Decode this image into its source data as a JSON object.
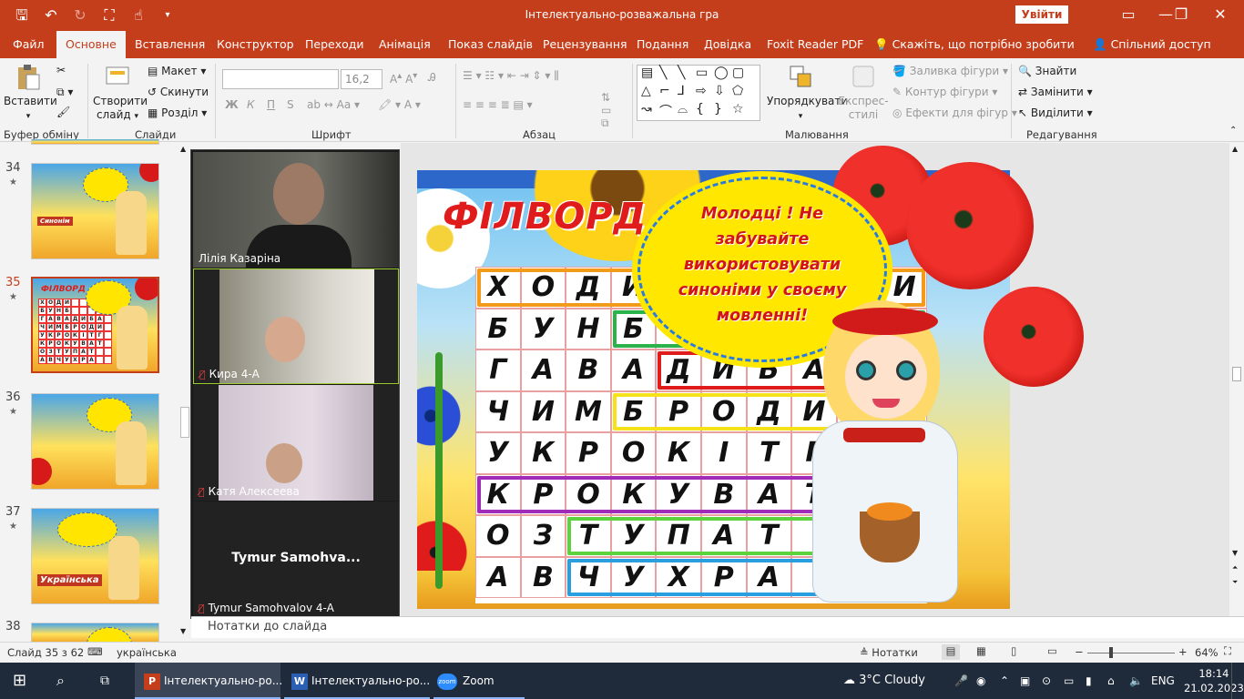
{
  "window": {
    "title": "Інтелектуально-розважальна гра",
    "signin_label": "Увійти"
  },
  "ribbon_tabs": [
    "Файл",
    "Основне",
    "Вставлення",
    "Конструктор",
    "Переходи",
    "Анімація",
    "Показ слайдів",
    "Рецензування",
    "Подання",
    "Довідка",
    "Foxit Reader PDF",
    "Скажіть, що потрібно зробити",
    "Спільний доступ"
  ],
  "ribbon": {
    "clipboard": {
      "paste": "Вставити",
      "group": "Буфер обміну"
    },
    "slides": {
      "new_slide": "Створити слайд",
      "layout": "Макет",
      "reset": "Скинути",
      "section": "Розділ",
      "group": "Слайди"
    },
    "font": {
      "name_value": "",
      "size_value": "16,2",
      "bold": "Ж",
      "italic": "К",
      "underline": "П",
      "strike": "S",
      "group": "Шрифт"
    },
    "paragraph": {
      "group": "Абзац"
    },
    "drawing": {
      "arrange": "Упорядкувати",
      "quick_styles": "Експрес-стилі",
      "fill": "Заливка фігури",
      "outline": "Контур фігури",
      "effects": "Ефекти для фігур",
      "group": "Малювання"
    },
    "editing": {
      "find": "Знайти",
      "replace": "Замінити",
      "select": "Виділити",
      "group": "Редагування"
    }
  },
  "thumbnails": [
    {
      "num": "34",
      "star": "★"
    },
    {
      "num": "35",
      "star": "★",
      "selected": true
    },
    {
      "num": "36",
      "star": "★"
    },
    {
      "num": "37",
      "star": "★"
    },
    {
      "num": "38",
      "star": ""
    }
  ],
  "thumb_texts": {
    "t34_label": "Синонім",
    "t37_label": "Українська",
    "t35_title": "ФІЛВОРД"
  },
  "zoom": {
    "participants": [
      {
        "name": "Лілія Казаріна",
        "muted": false
      },
      {
        "name": "Кира 4-А",
        "muted": true
      },
      {
        "name": "Катя Алексеева",
        "muted": true
      },
      {
        "name": "Tymur Samohvalov 4-A",
        "muted": true,
        "display": "Tymur  Samohva..."
      }
    ]
  },
  "slide": {
    "title": "ФІЛВОРД",
    "bubble_text": "Молодці ! Не забувайте використовувати синоніми у своєму мовленні!",
    "grid": [
      [
        "Х",
        "О",
        "Д",
        "И",
        "",
        "",
        "",
        "",
        "",
        "И"
      ],
      [
        "Б",
        "У",
        "Н",
        "Б",
        "",
        "",
        "",
        "",
        "",
        ""
      ],
      [
        "Г",
        "А",
        "В",
        "А",
        "Д",
        "И",
        "Б",
        "А",
        "",
        ""
      ],
      [
        "Ч",
        "И",
        "М",
        "Б",
        "Р",
        "О",
        "Д",
        "И",
        "",
        ""
      ],
      [
        "У",
        "К",
        "Р",
        "О",
        "К",
        "І",
        "Т",
        "Г",
        "",
        ""
      ],
      [
        "К",
        "Р",
        "О",
        "К",
        "У",
        "В",
        "А",
        "Т",
        "",
        ""
      ],
      [
        "О",
        "З",
        "Т",
        "У",
        "П",
        "А",
        "Т",
        "",
        "",
        ""
      ],
      [
        "А",
        "В",
        "Ч",
        "У",
        "Х",
        "Р",
        "А",
        "",
        "",
        ""
      ]
    ],
    "highlight_colors": {
      "orange": "#f39a1b",
      "green": "#2bb24a",
      "red": "#e01b1b",
      "yellow": "#f5e21a",
      "purple": "#a02bb8",
      "lightgreen": "#5cd23c",
      "blue": "#2a9fe0"
    }
  },
  "notes_placeholder": "Нотатки до слайда",
  "status": {
    "slide_info": "Слайд 35 з 62",
    "language": "українська",
    "notes": "Нотатки",
    "zoom": "64%"
  },
  "taskbar": {
    "items": [
      "Інтелектуально-ро...",
      "Інтелектуально-ро...",
      "Zoom"
    ],
    "weather": "3°C  Cloudy",
    "lang": "ENG",
    "time": "18:14",
    "date": "21.02.2023"
  }
}
